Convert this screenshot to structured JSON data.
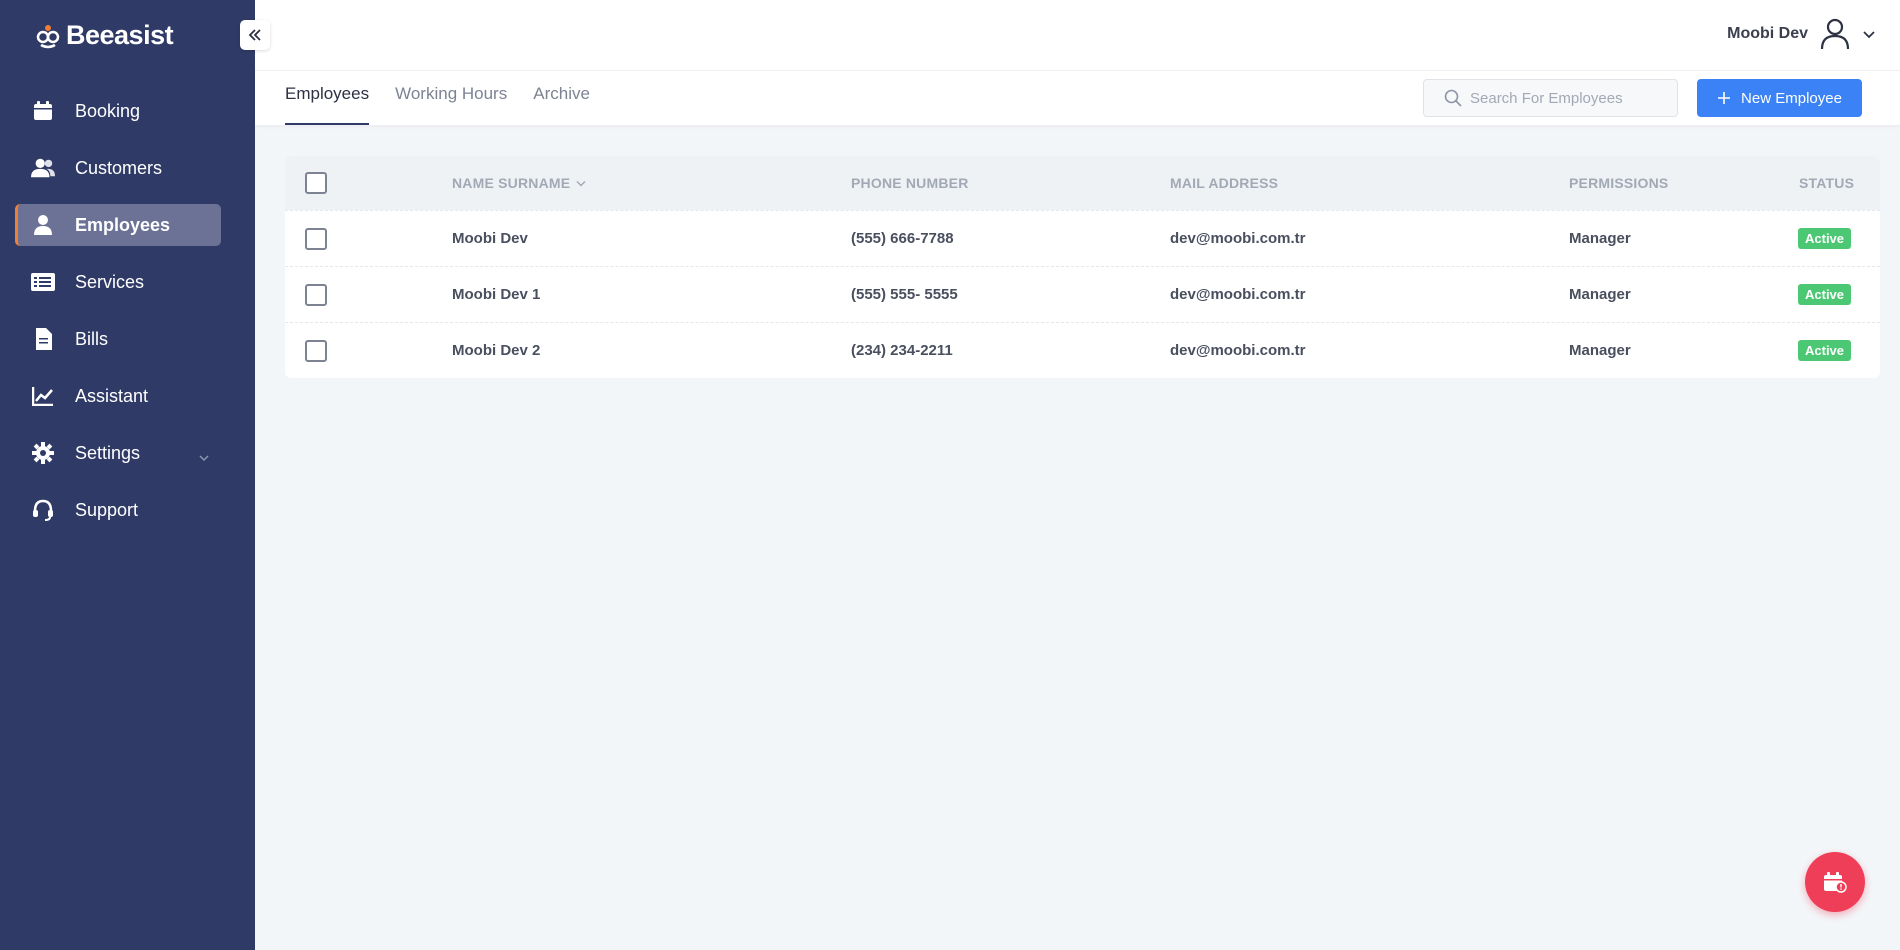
{
  "app": {
    "brand": "Beeasist",
    "accent_color": "#f07f36",
    "primary_color": "#3b82f6",
    "sidebar_color": "#2f3b66"
  },
  "sidebar": {
    "items": [
      {
        "label": "Booking",
        "icon": "calendar-icon"
      },
      {
        "label": "Customers",
        "icon": "users-icon"
      },
      {
        "label": "Employees",
        "icon": "user-icon",
        "active": true
      },
      {
        "label": "Services",
        "icon": "list-icon"
      },
      {
        "label": "Bills",
        "icon": "file-icon"
      },
      {
        "label": "Assistant",
        "icon": "chart-line-icon"
      },
      {
        "label": "Settings",
        "icon": "gear-icon",
        "has_submenu": true
      },
      {
        "label": "Support",
        "icon": "headset-icon"
      }
    ]
  },
  "header": {
    "user_name": "Moobi Dev"
  },
  "tabs": [
    {
      "label": "Employees",
      "active": true
    },
    {
      "label": "Working Hours"
    },
    {
      "label": "Archive"
    }
  ],
  "search": {
    "placeholder": "Search For Employees",
    "value": ""
  },
  "actions": {
    "new_employee_label": "New Employee"
  },
  "table": {
    "columns": {
      "name": "NAME SURNAME",
      "phone": "PHONE NUMBER",
      "mail": "MAIL ADDRESS",
      "permissions": "PERMISSIONS",
      "status": "STATUS"
    },
    "rows": [
      {
        "name": "Moobi Dev",
        "phone": "(555) 666-7788",
        "mail": "dev@moobi.com.tr",
        "permissions": "Manager",
        "status": "Active"
      },
      {
        "name": "Moobi Dev 1",
        "phone": "(555) 555- 5555",
        "mail": "dev@moobi.com.tr",
        "permissions": "Manager",
        "status": "Active"
      },
      {
        "name": "Moobi Dev 2",
        "phone": "(234) 234-2211",
        "mail": "dev@moobi.com.tr",
        "permissions": "Manager",
        "status": "Active"
      }
    ]
  }
}
